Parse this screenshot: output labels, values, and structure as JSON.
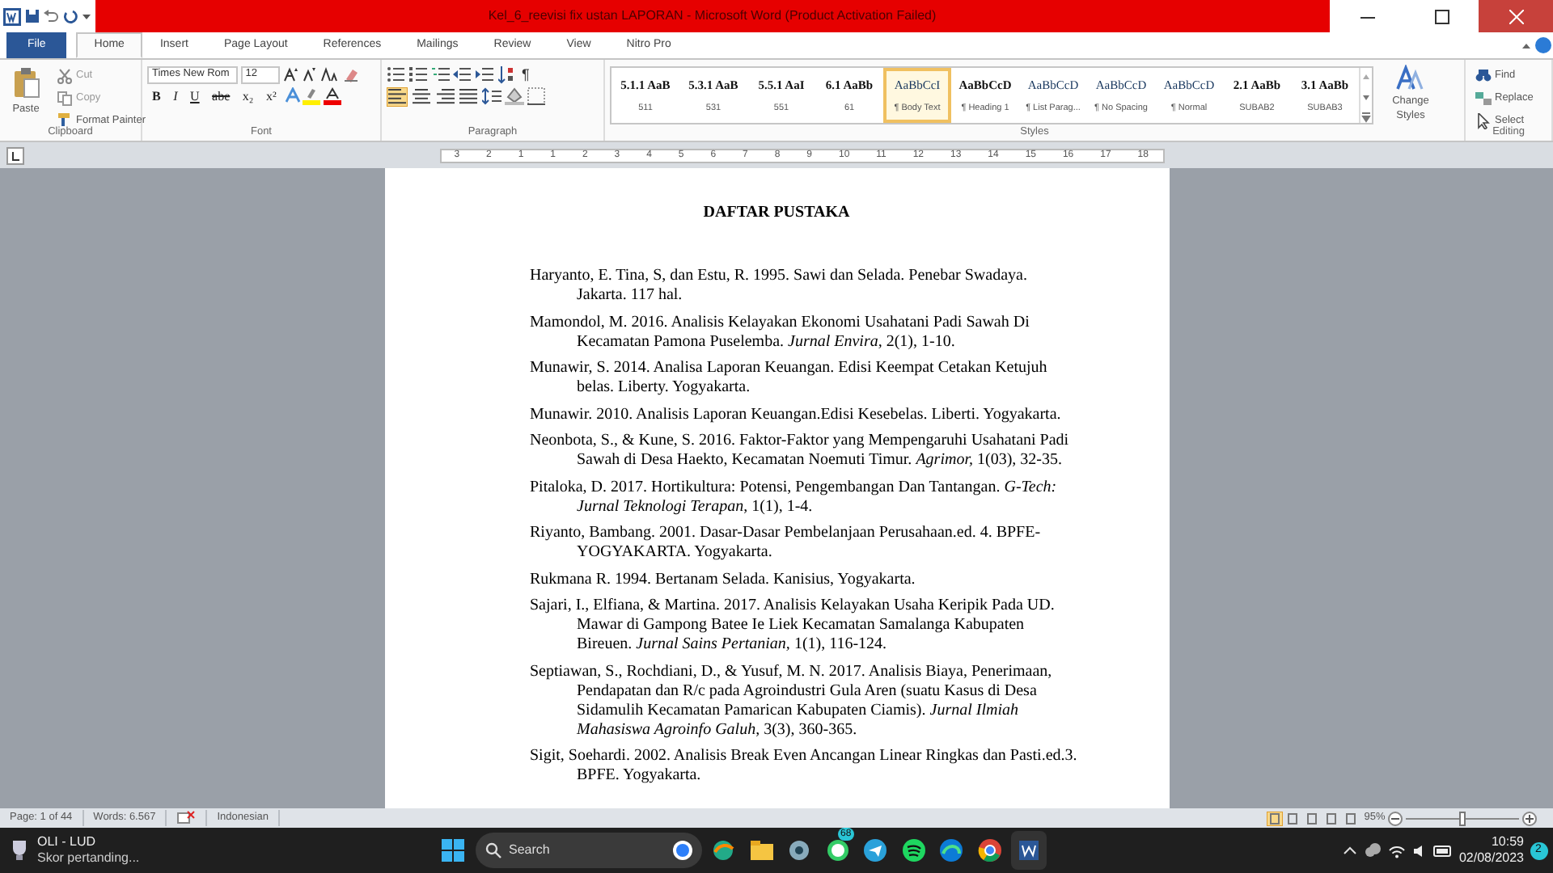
{
  "window": {
    "title": "Kel_6_reevisi fix ustan LAPORAN  -  Microsoft Word (Product Activation Failed)"
  },
  "tabs": [
    {
      "label": "File",
      "selected": false,
      "kind": "file"
    },
    {
      "label": "Home",
      "selected": true,
      "kind": "tab"
    },
    {
      "label": "Insert",
      "selected": false,
      "kind": "tab"
    },
    {
      "label": "Page Layout",
      "selected": false,
      "kind": "tab"
    },
    {
      "label": "References",
      "selected": false,
      "kind": "tab"
    },
    {
      "label": "Mailings",
      "selected": false,
      "kind": "tab"
    },
    {
      "label": "Review",
      "selected": false,
      "kind": "tab"
    },
    {
      "label": "View",
      "selected": false,
      "kind": "tab"
    },
    {
      "label": "Nitro Pro",
      "selected": false,
      "kind": "tab"
    }
  ],
  "clipboard": {
    "label": "Clipboard",
    "paste": "Paste",
    "cut": "Cut",
    "copy": "Copy",
    "format_painter": "Format Painter"
  },
  "font": {
    "label": "Font",
    "name": "Times New Rom",
    "size": "12",
    "buttons": [
      {
        "text": "B",
        "kind": "bold"
      },
      {
        "text": "I",
        "kind": "italic"
      },
      {
        "text": "U",
        "kind": "underline"
      },
      {
        "text": "abe",
        "kind": "strike"
      },
      {
        "text": "x₂",
        "kind": "plain"
      },
      {
        "text": "x²",
        "kind": "plain"
      }
    ]
  },
  "paragraph": {
    "label": "Paragraph",
    "pilcrow": "¶",
    "align": [
      {
        "kind": "left",
        "selected": true
      },
      {
        "kind": "center",
        "selected": false
      },
      {
        "kind": "right",
        "selected": false
      },
      {
        "kind": "justify",
        "selected": false
      }
    ]
  },
  "styles": {
    "label": "Styles",
    "items": [
      {
        "preview": "5.1.1  AaB",
        "name": "511",
        "bold": true,
        "selected": false
      },
      {
        "preview": "5.3.1  AaB",
        "name": "531",
        "bold": true,
        "selected": false
      },
      {
        "preview": "5.5.1  AaI",
        "name": "551",
        "bold": true,
        "selected": false
      },
      {
        "preview": "6.1  AaBb",
        "name": "61",
        "bold": true,
        "selected": false
      },
      {
        "preview": "AaBbCcI",
        "name": "¶ Body Text",
        "bold": false,
        "selected": true
      },
      {
        "preview": "AaBbCcD",
        "name": "¶ Heading 1",
        "bold": true,
        "selected": false
      },
      {
        "preview": "AaBbCcD",
        "name": "¶ List Parag...",
        "bold": false,
        "selected": false
      },
      {
        "preview": "AaBbCcD",
        "name": "¶ No Spacing",
        "bold": false,
        "selected": false
      },
      {
        "preview": "AaBbCcD",
        "name": "¶ Normal",
        "bold": false,
        "selected": false
      },
      {
        "preview": "2.1  AaBb",
        "name": "SUBAB2",
        "bold": true,
        "selected": false
      },
      {
        "preview": "3.1  AaBb",
        "name": "SUBAB3",
        "bold": true,
        "selected": false
      }
    ],
    "change_styles": "Change Styles"
  },
  "editing": {
    "label": "Editing",
    "find": "Find",
    "replace": "Replace",
    "select": "Select"
  },
  "ruler": {
    "labels": [
      "3",
      "2",
      "1",
      "1",
      "2",
      "3",
      "4",
      "5",
      "6",
      "7",
      "8",
      "9",
      "10",
      "11",
      "12",
      "13",
      "14",
      "15",
      "16",
      "17",
      "18"
    ]
  },
  "document": {
    "heading": "DAFTAR PUSTAKA",
    "references": [
      "Haryanto, E. Tina, S, dan Estu, R. 1995. Sawi dan Selada. Penebar Swadaya. Jakarta. 117 hal.",
      "Mamondol, M. 2016. Analisis Kelayakan Ekonomi Usahatani Padi Sawah Di Kecamatan Pamona Puselemba. *Jurnal Envira,* 2(1), 1-10.",
      "Munawir, S. 2014. Analisa Laporan Keuangan. Edisi Keempat Cetakan Ketujuh belas. Liberty. Yogyakarta.",
      "Munawir. 2010. Analisis Laporan Keuangan.Edisi Kesebelas. Liberti. Yogyakarta.",
      "Neonbota, S., & Kune, S. 2016. Faktor-Faktor yang Mempengaruhi Usahatani Padi Sawah di Desa Haekto, Kecamatan Noemuti Timur. *Agrimor,* 1(03), 32-35.",
      "Pitaloka, D. 2017. Hortikultura: Potensi, Pengembangan Dan Tantangan. *G-Tech: Jurnal Teknologi Terapan*, 1(1), 1-4.",
      "Riyanto, Bambang. 2001. Dasar-Dasar Pembelanjaan Perusahaan.ed. 4. BPFE-YOGYAKARTA. Yogyakarta.",
      "Rukmana R. 1994. Bertanam Selada. Kanisius, Yogyakarta.",
      "Sajari, I., Elfiana, & Martina. 2017. Analisis Kelayakan Usaha Keripik Pada UD. Mawar di Gampong Batee Ie Liek Kecamatan Samalanga Kabupaten Bireuen. *Jurnal Sains Pertanian,* 1(1), 116-124.",
      "Septiawan, S., Rochdiani, D., & Yusuf, M. N. 2017. Analisis Biaya, Penerimaan, Pendapatan dan R/c pada Agroindustri Gula Aren (suatu Kasus di Desa Sidamulih Kecamatan Pamarican Kabupaten Ciamis). *Jurnal Ilmiah Mahasiswa Agroinfo Galuh*, 3(3), 360-365.",
      "Sigit, Soehardi. 2002. Analisis Break Even Ancangan Linear Ringkas dan Pasti.ed.3. BPFE. Yogyakarta."
    ]
  },
  "status_bar": {
    "page": "Page: 1 of 44",
    "words": "Words: 6.567",
    "language": "Indonesian",
    "zoom": "95%",
    "zoom_slider": {
      "level": 0.5
    }
  },
  "taskbar": {
    "notification_title": "OLI - LUD",
    "notification_text": "Skor pertanding...",
    "search": "Search",
    "whatsapp_badge": "68",
    "time": "10:59",
    "date": "02/08/2023",
    "notification_count": "2"
  }
}
